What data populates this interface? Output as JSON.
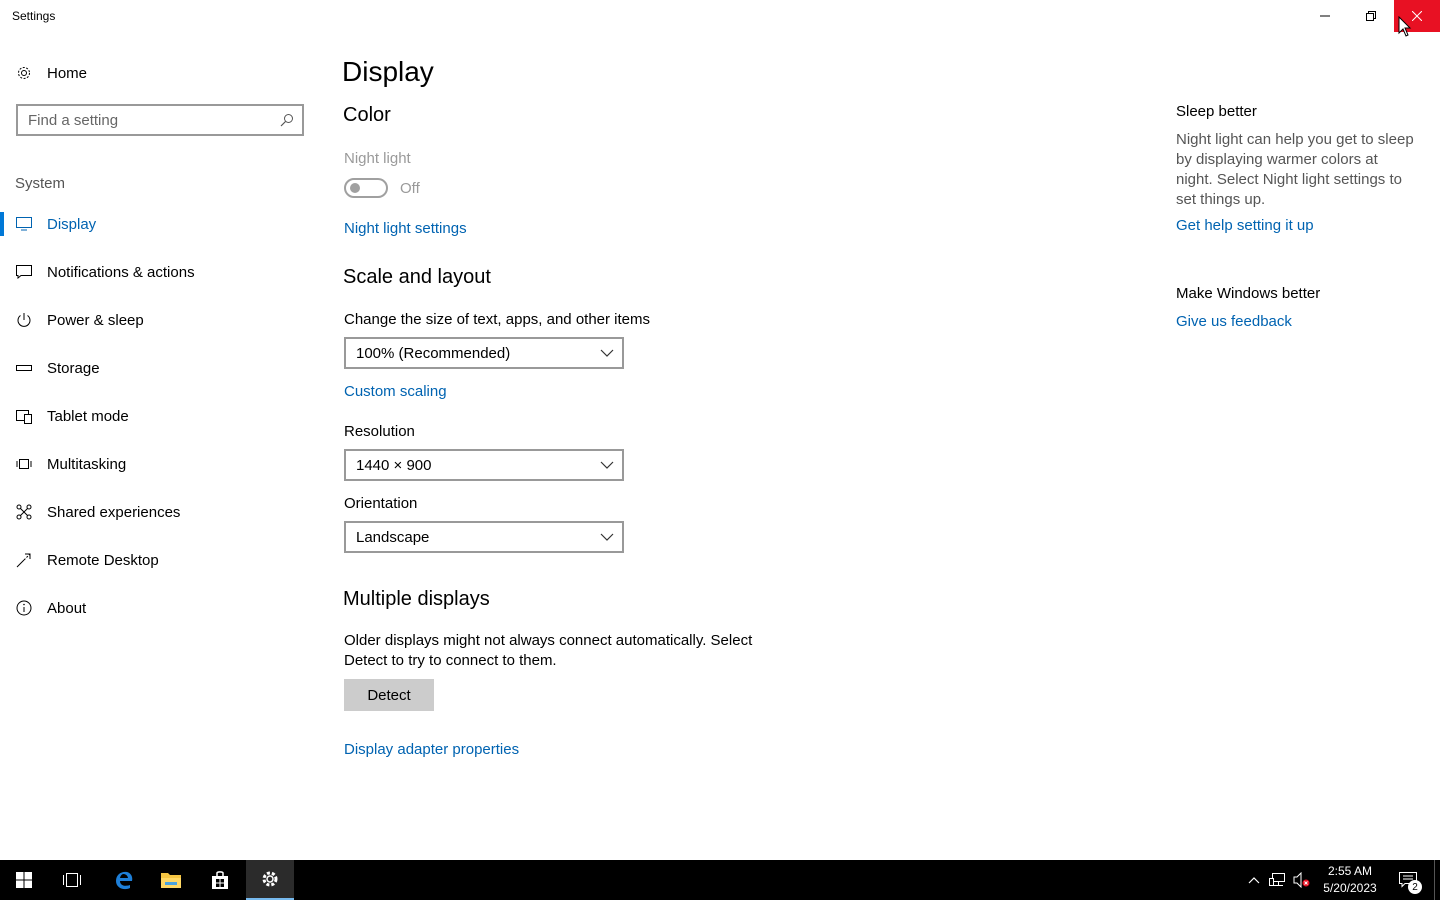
{
  "window": {
    "title": "Settings"
  },
  "sidebar": {
    "home_label": "Home",
    "search_placeholder": "Find a setting",
    "group_label": "System",
    "items": [
      {
        "label": "Display",
        "icon": "monitor-icon",
        "active": true
      },
      {
        "label": "Notifications & actions",
        "icon": "notification-icon",
        "active": false
      },
      {
        "label": "Power & sleep",
        "icon": "power-icon",
        "active": false
      },
      {
        "label": "Storage",
        "icon": "storage-icon",
        "active": false
      },
      {
        "label": "Tablet mode",
        "icon": "tablet-mode-icon",
        "active": false
      },
      {
        "label": "Multitasking",
        "icon": "multitasking-icon",
        "active": false
      },
      {
        "label": "Shared experiences",
        "icon": "shared-experiences-icon",
        "active": false
      },
      {
        "label": "Remote Desktop",
        "icon": "remote-desktop-icon",
        "active": false
      },
      {
        "label": "About",
        "icon": "info-icon",
        "active": false
      }
    ]
  },
  "main": {
    "title": "Display",
    "color_section": {
      "heading": "Color",
      "night_light_label": "Night light",
      "night_light_state": "Off",
      "night_light_on": false,
      "night_light_settings_link": "Night light settings"
    },
    "scale_section": {
      "heading": "Scale and layout",
      "size_label": "Change the size of text, apps, and other items",
      "size_value": "100% (Recommended)",
      "custom_scaling_link": "Custom scaling",
      "resolution_label": "Resolution",
      "resolution_value": "1440 × 900",
      "orientation_label": "Orientation",
      "orientation_value": "Landscape"
    },
    "multiple_displays": {
      "heading": "Multiple displays",
      "description": "Older displays might not always connect automatically. Select Detect to try to connect to them.",
      "detect_button": "Detect",
      "adapter_link": "Display adapter properties"
    }
  },
  "aside": {
    "sleep_heading": "Sleep better",
    "sleep_text": "Night light can help you get to sleep by displaying warmer colors at night. Select Night light settings to set things up.",
    "sleep_link": "Get help setting it up",
    "feedback_heading": "Make Windows better",
    "feedback_link": "Give us feedback"
  },
  "taskbar": {
    "time": "2:55 AM",
    "date": "5/20/2023",
    "notification_count": "2",
    "apps": [
      "start-icon",
      "task-view-icon",
      "edge-icon",
      "file-explorer-icon",
      "store-icon",
      "settings-icon"
    ]
  },
  "colors": {
    "accent": "#0078d7",
    "link": "#0063b1",
    "close_hover": "#e81123",
    "taskbar": "#000000"
  }
}
